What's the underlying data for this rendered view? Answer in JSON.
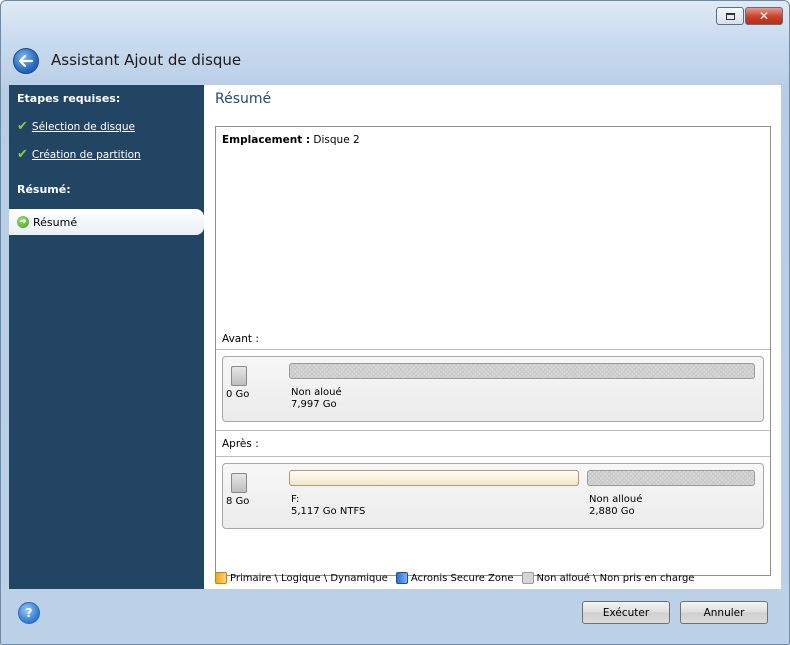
{
  "window": {
    "title": "Assistant Ajout de disque"
  },
  "sidebar": {
    "section_required": "Etapes requises:",
    "steps": [
      {
        "label": "Sélection de disque"
      },
      {
        "label": "Création de partition"
      }
    ],
    "section_summary": "Résumé:",
    "active_item": "Résumé"
  },
  "main": {
    "title": "Résumé",
    "location_label": "Emplacement :",
    "location_value": "Disque 2",
    "before_label": "Avant :",
    "after_label": "Après :",
    "before_disk": {
      "size": "0 Go",
      "partitions": [
        {
          "name": "Non aloué",
          "size": "7,997 Go"
        }
      ]
    },
    "after_disk": {
      "size": "8 Go",
      "partitions": [
        {
          "name": "F:",
          "size": "5,117 Go  NTFS"
        },
        {
          "name": "Non alloué",
          "size": "2,880 Go"
        }
      ]
    },
    "legend": [
      {
        "label": "Primaire \\ Logique \\ Dynamique",
        "color": "#f1a91c"
      },
      {
        "label": "Acronis Secure Zone",
        "color": "#2c6fd0"
      },
      {
        "label": "Non alloué \\ Non pris en charge",
        "color": "#d5d5d5"
      }
    ]
  },
  "footer": {
    "execute_label": "Exécuter",
    "cancel_label": "Annuler"
  }
}
